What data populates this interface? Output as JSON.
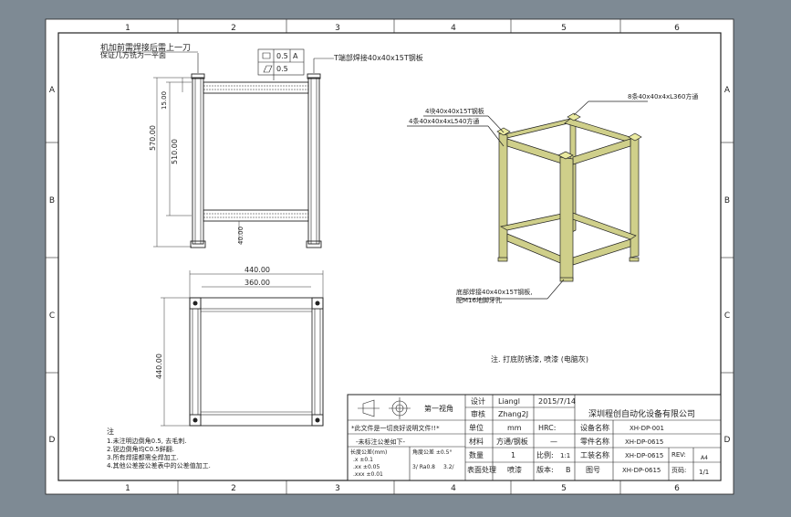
{
  "zones": {
    "columns": [
      "1",
      "2",
      "3",
      "4",
      "5",
      "6"
    ],
    "rows": [
      "A",
      "B",
      "C",
      "D"
    ]
  },
  "notes": {
    "top_left_1": "机加前需焊接后需上一刀",
    "top_left_2": "保证几方铣为一平面",
    "tol_flat": "0.5",
    "tol_par": "0.5",
    "tol_datum": "A",
    "top_plate": "T端部焊接40x40x15T钢板",
    "callout_plate": "4块40x40x15T钢板",
    "callout_tube4": "4条40x40x4xL540方通",
    "callout_tube8": "8条40x40x4xL360方通",
    "callout_base_1": "底部焊接40x40x15T钢板,",
    "callout_base_2": "配M16地脚牙孔",
    "paint_note": "注. 打底防锈漆, 喷漆 (电脑灰)",
    "general_title": "注",
    "general_1": "1.未注明边倒角0.5, 去毛刺.",
    "general_2": "2.锐边倒角均C0.5鲜翻.",
    "general_3": "3.所有焊接都需全焊加工.",
    "general_4": "4.其他公差按公差表中的公差值加工."
  },
  "dims": {
    "h570": "570.00",
    "h510": "510.00",
    "d15": "15.00",
    "d40": "40.00",
    "w440": "440.00",
    "w360": "360.00",
    "v440": "440.00"
  },
  "title_block": {
    "projection": "第一视角",
    "design_label": "设计",
    "design_name": "Liangl",
    "design_date": "2015/7/14",
    "check_label": "审核",
    "check_name": "Zhang2J",
    "company": "深圳程创自动化设备有限公司",
    "unit_label": "单位",
    "unit_val": "mm",
    "hrc_label": "HRC:",
    "hrc_val": "—",
    "material_label": "材料",
    "material_val": "方通/钢板",
    "qty_label": "数量",
    "qty_val": "1",
    "scale_label": "比例:",
    "scale_val": "1:1",
    "surface_label": "表面处理",
    "surface_val": "喷漆",
    "version_label": "版本:",
    "version_val": "B",
    "device_name_label": "设备名称",
    "device_name_val": "XH-DP-001",
    "part_name_label": "零件名称",
    "part_name_val": "XH-DP-0615",
    "drawing_no_label": "工装名称",
    "drawing_no_val": "XH-DP-0615",
    "figno_label": "图号",
    "figno_val": "XH-DP-0615",
    "rev_label": "REV:",
    "rev_val": "A4",
    "page_label": "页码:",
    "page_val": "1/1",
    "warn1": "*此文件是一切良好说明文件!!*",
    "warn2": "-未标注公差如下-",
    "tol_hdr1": "长度公差(mm)",
    "tol_hdr2": "角度公差 ±0.5°",
    "tol_r1": ".x    ±0.1",
    "tol_r2": ".xx   ±0.05",
    "tol_r3": ".xxx  ±0.01",
    "tol_surface": "3/ Ra0.8",
    "tol_rough": "3.2/"
  }
}
